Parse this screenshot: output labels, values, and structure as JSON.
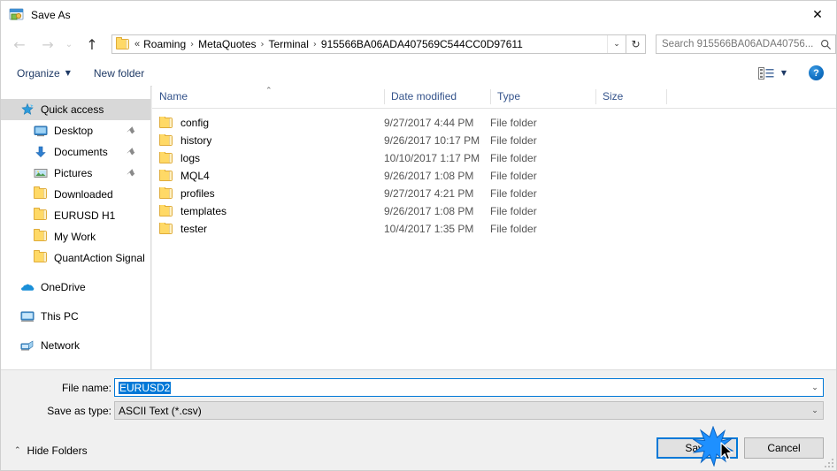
{
  "window": {
    "title": "Save As",
    "icon": "save-as-app-icon",
    "close_label": "✕"
  },
  "nav": {
    "back_icon": "←",
    "forward_icon": "→",
    "recent_icon": "⌄",
    "up_icon": "↑",
    "refresh_icon": "↻",
    "dropdown_icon": "⌄",
    "breadcrumb_lead": "«",
    "separator": "›",
    "breadcrumbs": [
      "Roaming",
      "MetaQuotes",
      "Terminal",
      "915566BA06ADA407569C544CC0D97611"
    ]
  },
  "search": {
    "placeholder": "Search 915566BA06ADA40756...",
    "icon": "search-icon"
  },
  "toolbar": {
    "organize_label": "Organize",
    "organize_caret": "▼",
    "new_folder_label": "New folder",
    "view_caret": "▼",
    "help_label": "?"
  },
  "sidebar": {
    "items": [
      {
        "label": "Quick access",
        "icon": "quick-access-star-icon",
        "level": 0,
        "selected": true,
        "pinned": false
      },
      {
        "label": "Desktop",
        "icon": "desktop-icon",
        "level": 1,
        "selected": false,
        "pinned": true
      },
      {
        "label": "Documents",
        "icon": "documents-down-arrow-icon",
        "level": 1,
        "selected": false,
        "pinned": true
      },
      {
        "label": "Pictures",
        "icon": "pictures-icon",
        "level": 1,
        "selected": false,
        "pinned": true
      },
      {
        "label": "Downloaded",
        "icon": "folder-icon",
        "level": 1,
        "selected": false,
        "pinned": false
      },
      {
        "label": "EURUSD H1",
        "icon": "folder-icon",
        "level": 1,
        "selected": false,
        "pinned": false
      },
      {
        "label": "My Work",
        "icon": "folder-icon",
        "level": 1,
        "selected": false,
        "pinned": false
      },
      {
        "label": "QuantAction Signal",
        "icon": "folder-icon",
        "level": 1,
        "selected": false,
        "pinned": false
      },
      {
        "label": "OneDrive",
        "icon": "onedrive-cloud-icon",
        "level": 0,
        "selected": false,
        "pinned": false,
        "group": true
      },
      {
        "label": "This PC",
        "icon": "this-pc-monitor-icon",
        "level": 0,
        "selected": false,
        "pinned": false,
        "group": true
      },
      {
        "label": "Network",
        "icon": "network-icon",
        "level": 0,
        "selected": false,
        "pinned": false,
        "group": true
      }
    ],
    "pin_glyph": "⚑"
  },
  "filelist": {
    "columns": [
      "Name",
      "Date modified",
      "Type",
      "Size"
    ],
    "sort_caret": "⌃",
    "rows": [
      {
        "name": "config",
        "date": "9/27/2017 4:44 PM",
        "type": "File folder",
        "size": ""
      },
      {
        "name": "history",
        "date": "9/26/2017 10:17 PM",
        "type": "File folder",
        "size": ""
      },
      {
        "name": "logs",
        "date": "10/10/2017 1:17 PM",
        "type": "File folder",
        "size": ""
      },
      {
        "name": "MQL4",
        "date": "9/26/2017 1:08 PM",
        "type": "File folder",
        "size": ""
      },
      {
        "name": "profiles",
        "date": "9/27/2017 4:21 PM",
        "type": "File folder",
        "size": ""
      },
      {
        "name": "templates",
        "date": "9/26/2017 1:08 PM",
        "type": "File folder",
        "size": ""
      },
      {
        "name": "tester",
        "date": "10/4/2017 1:35 PM",
        "type": "File folder",
        "size": ""
      }
    ]
  },
  "form": {
    "filename_label": "File name:",
    "filename_value": "EURUSD2",
    "filetype_label": "Save as type:",
    "filetype_value": "ASCII Text (*.csv)",
    "dropdown_icon": "⌄"
  },
  "footer": {
    "hide_folders_label": "Hide Folders",
    "hide_folders_caret": "⌃",
    "save_label": "Save",
    "cancel_label": "Cancel"
  },
  "colors": {
    "accent": "#0078d7",
    "header_text": "#34538b",
    "toolbar_text": "#1f3a66",
    "folder_yellow": "#ffd966",
    "selection_grey": "#d8d8d8"
  }
}
